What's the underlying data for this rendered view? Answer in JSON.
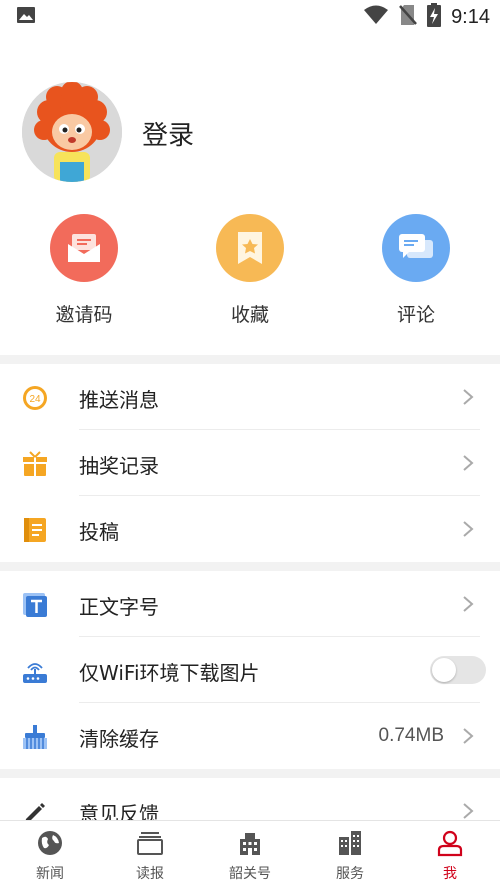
{
  "status_bar": {
    "time": "9:14",
    "icons": [
      "image-icon",
      "wifi-icon",
      "no-sim-icon",
      "battery-charging-icon"
    ]
  },
  "profile": {
    "login_label": "登录",
    "avatar_icon": "mascot-avatar-icon"
  },
  "quick_actions": [
    {
      "label": "邀请码",
      "icon": "mail-icon",
      "color": "#f26b5b"
    },
    {
      "label": "收藏",
      "icon": "bookmark-star-icon",
      "color": "#f7b955"
    },
    {
      "label": "评论",
      "icon": "chat-bubbles-icon",
      "color": "#6aaaf2"
    }
  ],
  "menu_group_1": [
    {
      "label": "推送消息",
      "icon": "push-24-icon"
    },
    {
      "label": "抽奖记录",
      "icon": "gift-icon"
    },
    {
      "label": "投稿",
      "icon": "notebook-icon"
    }
  ],
  "menu_group_2": [
    {
      "label": "正文字号",
      "icon": "font-size-icon"
    },
    {
      "label": "仅WiFi环境下载图片",
      "icon": "router-icon",
      "toggle_on": false
    },
    {
      "label": "清除缓存",
      "icon": "brush-icon",
      "value": "0.74MB"
    }
  ],
  "menu_group_3": [
    {
      "label": "意见反馈",
      "icon": "pencil-icon"
    }
  ],
  "tabbar": [
    {
      "label": "新闻",
      "icon": "globe-icon",
      "active": false
    },
    {
      "label": "读报",
      "icon": "newspaper-icon",
      "active": false
    },
    {
      "label": "韶关号",
      "icon": "building-icon",
      "active": false
    },
    {
      "label": "服务",
      "icon": "city-icon",
      "active": false
    },
    {
      "label": "我",
      "icon": "user-icon",
      "active": true
    }
  ],
  "colors": {
    "accent": "#d0021b",
    "orange": "#f5a623",
    "blue": "#3a7bd5"
  }
}
